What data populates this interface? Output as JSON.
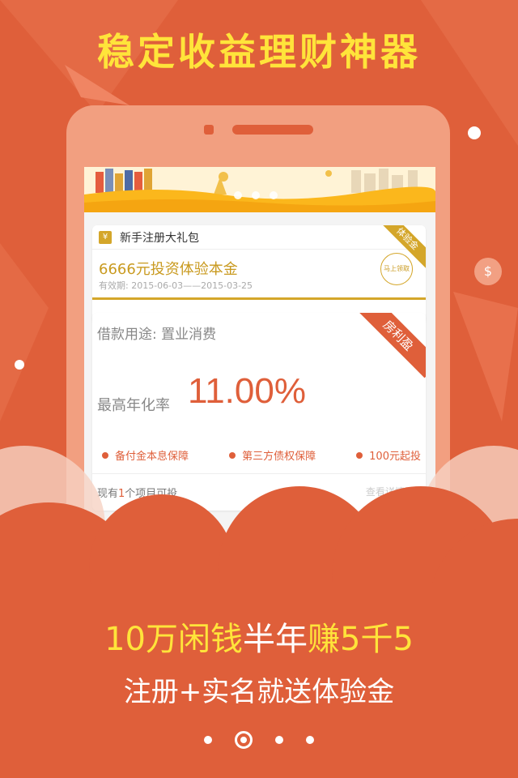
{
  "headline": "稳定收益理财神器",
  "gift": {
    "icon": "¥",
    "title": "新手注册大礼包",
    "ribbon": "体验金",
    "amount": "6666元投资体验本金",
    "validity": "有效期: 2015-06-03——2015-03-25",
    "claim_label": "马上领取"
  },
  "loan": {
    "purpose": "借款用途: 置业消费",
    "ribbon": "房利盈",
    "rate_label": "最高年化率",
    "rate": "11.00%",
    "features": [
      "备付金本息保障",
      "第三方债权保障",
      "100元起投"
    ],
    "count_prefix": "现有",
    "count_value": "1",
    "count_suffix": "个项目可投",
    "details_link": "查看详情>>"
  },
  "slogan": {
    "line1_a": "10万闲钱",
    "line1_b": "半年",
    "line1_c": "赚5千5",
    "line2": "注册+实名就送体验金"
  },
  "colors": {
    "background": "#df5f3a",
    "accent_yellow": "#ffe43a",
    "gold": "#d4a62a"
  },
  "icons": [
    "money-bag-icon",
    "coin-icon"
  ]
}
